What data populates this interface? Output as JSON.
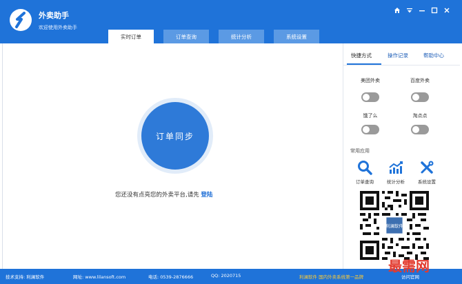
{
  "header": {
    "title": "外卖助手",
    "subtitle": "欢迎使用外卖助手",
    "controls": [
      "home-icon",
      "dropdown-icon",
      "minimize-icon",
      "maximize-icon",
      "close-icon"
    ]
  },
  "tabs": [
    {
      "label": "实时订单",
      "active": true
    },
    {
      "label": "订单查询",
      "active": false
    },
    {
      "label": "统计分析",
      "active": false
    },
    {
      "label": "系统设置",
      "active": false
    }
  ],
  "main": {
    "sync_button": "订单同步",
    "notice_text": "您还没有点亮您的外卖平台,请先",
    "login_link": "登陆"
  },
  "panel": {
    "tabs": [
      {
        "label": "快捷方式",
        "active": true
      },
      {
        "label": "操作记录",
        "active": false
      },
      {
        "label": "帮助中心",
        "active": false
      }
    ],
    "platforms": [
      {
        "label": "美团外卖",
        "on": false
      },
      {
        "label": "百度外卖",
        "on": false
      },
      {
        "label": "饿了么",
        "on": false
      },
      {
        "label": "淘点点",
        "on": false
      }
    ],
    "apps_title": "常用应用",
    "apps": [
      {
        "label": "订单查询",
        "icon": "search-icon"
      },
      {
        "label": "统计分析",
        "icon": "chart-icon"
      },
      {
        "label": "系统设置",
        "icon": "tools-icon"
      }
    ],
    "qr_center": "利澜软件"
  },
  "footer": {
    "support": "技术支持: 利澜软件",
    "website": "网址: www.lilansoft.com",
    "phone": "电话: 0539-2876666",
    "qq": "QQ: 2020715",
    "slogan": "利澜软件  国内外卖系统第一品牌",
    "visit_link": "访问官网"
  },
  "watermark": {
    "part1": "最",
    "part2": "需网"
  },
  "colors": {
    "primary": "#1f73d9",
    "tab_inactive": "#5b9ae4",
    "toggle_off": "#9a9a9a",
    "slogan": "#ffcc33"
  }
}
